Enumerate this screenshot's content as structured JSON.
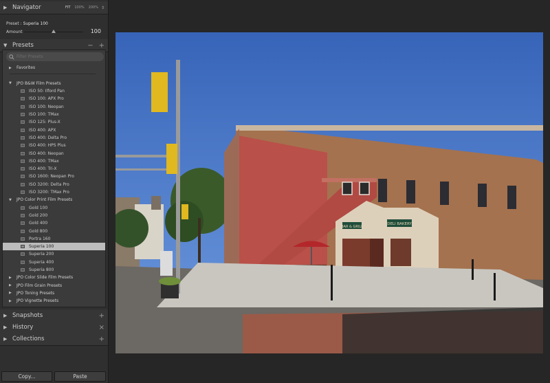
{
  "navigator": {
    "title": "Navigator",
    "zoom_fit": "FIT",
    "zoom_100": "100%",
    "zoom_200": "200%"
  },
  "preset_info": {
    "label": "Preset :",
    "value": "Superia 100",
    "amount_label": "Amount",
    "amount_value": "100",
    "amount_fraction": 0.5
  },
  "presets": {
    "title": "Presets",
    "minus": "−",
    "plus": "+",
    "search_placeholder": "Filter Presets",
    "favorites": "Favorites",
    "bw_folder": "JPO B&W Film Presets",
    "bw_items": [
      "ISO 50: Ilford Pan",
      "ISO 100: APX Pro",
      "ISO 100: Neopan",
      "ISO 100: TMax",
      "ISO 125: Plus-X",
      "ISO 400: APX",
      "ISO 400: Delta Pro",
      "ISO 400: HPS Plus",
      "ISO 400: Neopan",
      "ISO 400: TMax",
      "ISO 400: Tri-X",
      "ISO 1600: Neopan Pro",
      "ISO 3200: Delta Pro",
      "ISO 3200: TMax Pro"
    ],
    "color_folder": "JPO Color Print Film Presets",
    "color_items": [
      "Gold 100",
      "Gold 200",
      "Gold 400",
      "Gold 800",
      "Portra 160",
      "Superia 100",
      "Superia 200",
      "Superia 400",
      "Superia 800"
    ],
    "selected_item": "Superia 100",
    "other_folders": [
      "JPO Color Slide Film Presets",
      "JPO Film Grain Presets",
      "JPO Toning Presets",
      "JPO Vignette Presets"
    ]
  },
  "snapshots": {
    "title": "Snapshots",
    "action": "+"
  },
  "history": {
    "title": "History",
    "action": "×"
  },
  "collections": {
    "title": "Collections",
    "action": "+"
  },
  "buttons": {
    "copy": "Copy...",
    "paste": "Paste"
  },
  "photo": {
    "sign_left": "BAR & GRILL",
    "sign_right": "DELI BAKERY"
  },
  "colors": {
    "sidebar_bg": "#2f2f2f",
    "panel_bg": "#3b3b3b",
    "selected_row": "#bdbdbd",
    "canvas_bg": "#262626"
  }
}
